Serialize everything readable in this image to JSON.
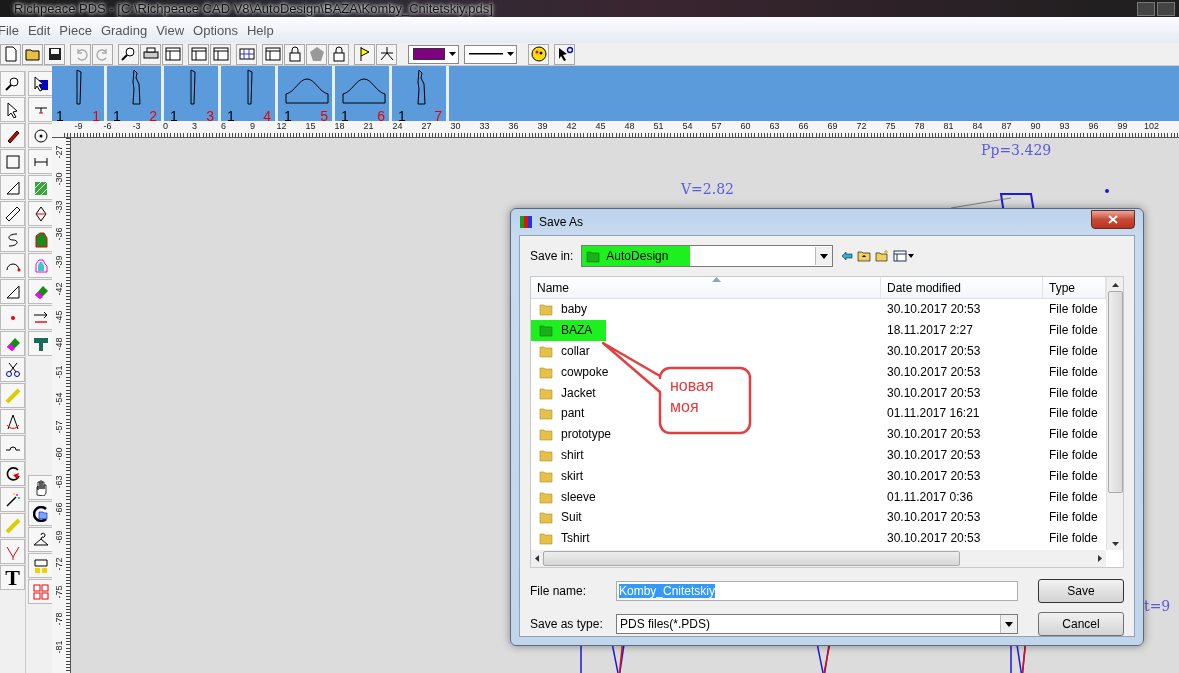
{
  "title_bar": {
    "title": "Richpeace PDS - [C:\\Richpeace CAD V8\\AutoDesign\\BAZA\\Komby_Cnitetskiy.pds]"
  },
  "menu": [
    "File",
    "Edit",
    "Piece",
    "Grading",
    "View",
    "Options",
    "Help"
  ],
  "pieces": [
    {
      "qty": "1",
      "number": "1",
      "kind": "strip"
    },
    {
      "qty": "1",
      "number": "2",
      "kind": "notched"
    },
    {
      "qty": "1",
      "number": "3",
      "kind": "strip"
    },
    {
      "qty": "1",
      "number": "4",
      "kind": "strip"
    },
    {
      "qty": "1",
      "number": "5",
      "kind": "arch"
    },
    {
      "qty": "1",
      "number": "6",
      "kind": "arch"
    },
    {
      "qty": "1",
      "number": "7",
      "kind": "notched"
    }
  ],
  "rulers": {
    "horizontal": [
      "-9",
      "-6",
      "-3",
      "0",
      "3",
      "6",
      "9",
      "12",
      "15",
      "18",
      "21",
      "24",
      "27",
      "30",
      "33",
      "36",
      "39",
      "42",
      "45",
      "48",
      "51",
      "54",
      "57",
      "60",
      "63",
      "66",
      "69",
      "72",
      "75",
      "78",
      "81",
      "84",
      "87",
      "90",
      "93",
      "96",
      "99",
      "102"
    ],
    "vertical": [
      "-27",
      "-30",
      "-33",
      "-36",
      "-39",
      "-42",
      "-45",
      "-48",
      "-51",
      "-54",
      "-57",
      "-60",
      "-63",
      "-66",
      "-69",
      "-72",
      "-75",
      "-78",
      "-81"
    ]
  },
  "tools": {
    "text_tool": "T"
  },
  "canvas": {
    "labels": [
      "Pp=3.429",
      "V=2.82",
      "t=9"
    ]
  },
  "dialog": {
    "title": "Save As",
    "save_in": {
      "label": "Save in:",
      "value": "AutoDesign",
      "highlighted": true
    },
    "columns": [
      "Name",
      "Date modified",
      "Type"
    ],
    "rows": [
      {
        "name": "baby",
        "date": "30.10.2017 20:53",
        "type": "File folde",
        "highlighted": false
      },
      {
        "name": "BAZA",
        "date": "18.11.2017 2:27",
        "type": "File folde",
        "highlighted": true
      },
      {
        "name": "collar",
        "date": "30.10.2017 20:53",
        "type": "File folde",
        "highlighted": false
      },
      {
        "name": "cowpoke",
        "date": "30.10.2017 20:53",
        "type": "File folde",
        "highlighted": false
      },
      {
        "name": "Jacket",
        "date": "30.10.2017 20:53",
        "type": "File folde",
        "highlighted": false
      },
      {
        "name": "pant",
        "date": "01.11.2017 16:21",
        "type": "File folde",
        "highlighted": false
      },
      {
        "name": "prototype",
        "date": "30.10.2017 20:53",
        "type": "File folde",
        "highlighted": false
      },
      {
        "name": "shirt",
        "date": "30.10.2017 20:53",
        "type": "File folde",
        "highlighted": false
      },
      {
        "name": "skirt",
        "date": "30.10.2017 20:53",
        "type": "File folde",
        "highlighted": false
      },
      {
        "name": "sleeve",
        "date": "01.11.2017 0:36",
        "type": "File folde",
        "highlighted": false
      },
      {
        "name": "Suit",
        "date": "30.10.2017 20:53",
        "type": "File folde",
        "highlighted": false
      },
      {
        "name": "Tshirt",
        "date": "30.10.2017 20:53",
        "type": "File folde",
        "highlighted": false
      }
    ],
    "file_name": {
      "label": "File name:",
      "value": "Komby_Cnitetskiy",
      "selected": true
    },
    "save_as_type": {
      "label": "Save as type:",
      "value": "PDS files(*.PDS)"
    },
    "buttons": [
      "Save",
      "Cancel"
    ]
  },
  "annotation": {
    "text": "новая\nмоя"
  }
}
